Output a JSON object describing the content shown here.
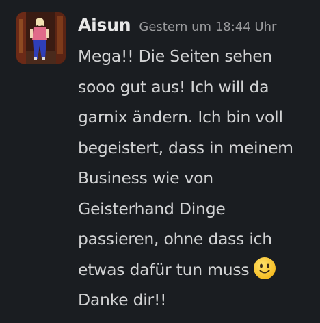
{
  "message": {
    "sender": "Aisun",
    "timestamp": "Gestern um 18:44 Uhr",
    "lines": [
      "Mega!! Die Seiten sehen",
      "sooo gut aus! Ich will da",
      "garnix ändern. Ich bin voll",
      "begeistert, dass in meinem",
      "Business wie von",
      "Geisterhand Dinge",
      "passieren, ohne dass ich",
      "etwas dafür tun muss",
      "Danke dir!!"
    ],
    "emoji": "slightly-smiling-face-icon"
  }
}
